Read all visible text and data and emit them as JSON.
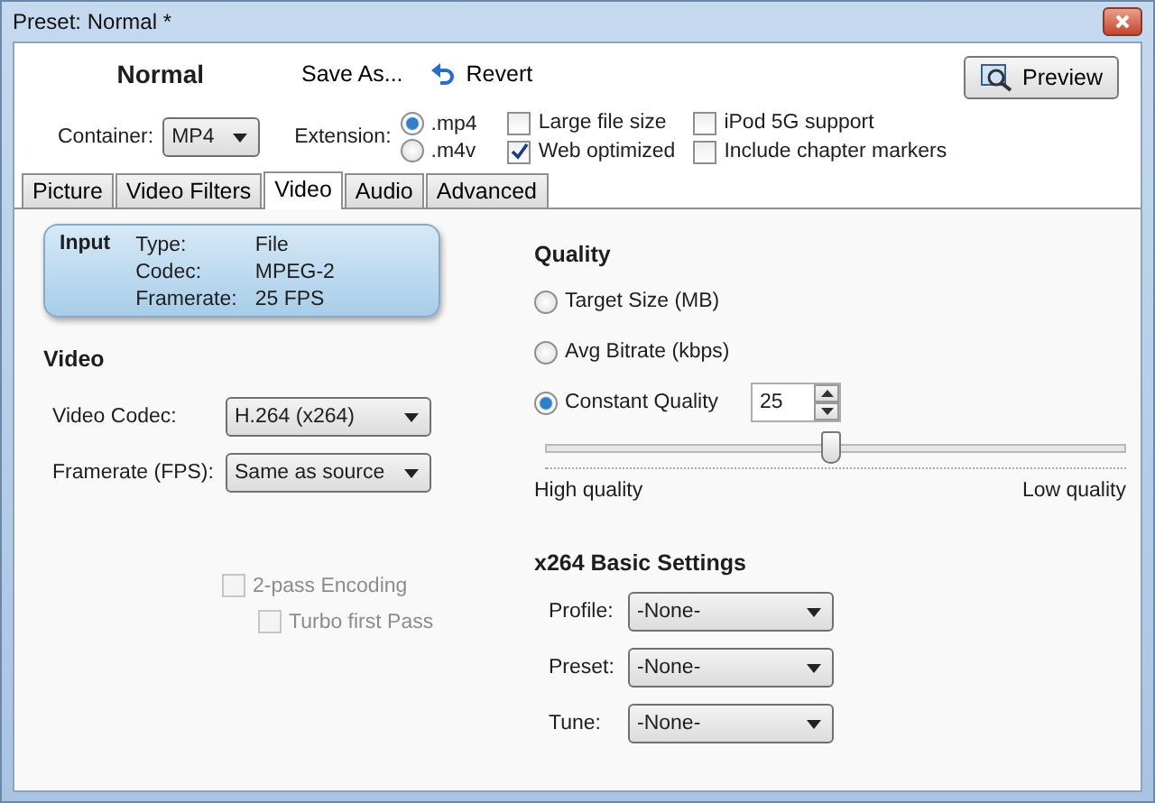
{
  "window": {
    "title": "Preset: Normal *"
  },
  "header": {
    "preset_name": "Normal",
    "save_as": "Save As...",
    "revert": "Revert",
    "preview": "Preview"
  },
  "container": {
    "label": "Container:",
    "value": "MP4"
  },
  "extension": {
    "label": "Extension:",
    "options": [
      {
        "label": ".mp4",
        "selected": true
      },
      {
        "label": ".m4v",
        "selected": false
      }
    ]
  },
  "options": [
    {
      "label": "Large file size",
      "checked": false
    },
    {
      "label": "Web optimized",
      "checked": true
    },
    {
      "label": "iPod 5G support",
      "checked": false
    },
    {
      "label": "Include chapter markers",
      "checked": false
    }
  ],
  "tabs": [
    {
      "label": "Picture",
      "selected": false
    },
    {
      "label": "Video Filters",
      "selected": false
    },
    {
      "label": "Video",
      "selected": true
    },
    {
      "label": "Audio",
      "selected": false
    },
    {
      "label": "Advanced",
      "selected": false
    }
  ],
  "input": {
    "title": "Input",
    "rows": [
      {
        "label": "Type:",
        "value": "File"
      },
      {
        "label": "Codec:",
        "value": "MPEG-2"
      },
      {
        "label": "Framerate:",
        "value": "25 FPS"
      }
    ]
  },
  "video": {
    "title": "Video",
    "fields": [
      {
        "label": "Video Codec:",
        "value": "H.264 (x264)"
      },
      {
        "label": "Framerate (FPS):",
        "value": "Same as source"
      }
    ],
    "passes": [
      {
        "label": "2-pass Encoding",
        "checked": false,
        "disabled": true
      },
      {
        "label": "Turbo first Pass",
        "checked": false,
        "disabled": true
      }
    ]
  },
  "quality": {
    "title": "Quality",
    "modes": [
      {
        "label": "Target Size (MB)",
        "selected": false
      },
      {
        "label": "Avg Bitrate (kbps)",
        "selected": false
      },
      {
        "label": "Constant Quality",
        "selected": true
      }
    ],
    "value": "25",
    "slider": {
      "level": 0.49
    },
    "low_end": "High quality",
    "high_end": "Low quality"
  },
  "x264": {
    "title": "x264 Basic Settings",
    "fields": [
      {
        "label": "Profile:",
        "value": "-None-"
      },
      {
        "label": "Preset:",
        "value": "-None-"
      },
      {
        "label": "Tune:",
        "value": "-None-"
      }
    ]
  }
}
